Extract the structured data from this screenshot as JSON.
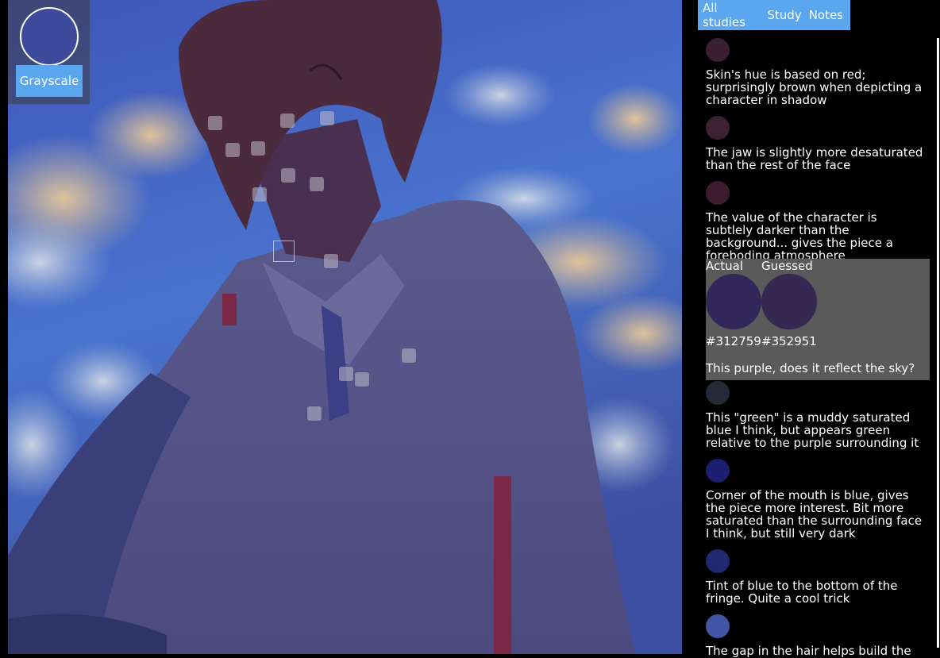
{
  "grayscale": {
    "button_label": "Grayscale",
    "swatch_color": "#3e4a9c"
  },
  "nav": {
    "items": [
      "All studies",
      "Study",
      "Notes"
    ],
    "accent_color": "#5aa7ef"
  },
  "notes": [
    {
      "color": "#3a1f33",
      "text": "Skin's hue is based on red; surprisingly brown when depicting a character in shadow"
    },
    {
      "color": "#3b2132",
      "text": "The jaw is slightly more desaturated than the rest of the face"
    },
    {
      "color": "#3e1c30",
      "text": "The value of the character is subtlely darker than the background... gives the piece a foreboding atmosphere"
    },
    {
      "color": "#252b36",
      "text": "This \"green\" is a muddy saturated blue I think, but appears green relative to the purple surrounding it"
    },
    {
      "color": "#1c1e6f",
      "text": "Corner of the mouth is blue, gives the piece more interest. Bit more saturated than the surrounding face I think, but still very dark"
    },
    {
      "color": "#1e2a6d",
      "text": "Tint of blue to the bottom of the fringe. Quite a cool trick"
    },
    {
      "color": "#4254a3",
      "text": "The gap in the hair helps build the"
    }
  ],
  "active_note": {
    "actual_label": "Actual",
    "guessed_label": "Guessed",
    "actual_hex": "#312759",
    "guessed_hex": "#352951",
    "actual_color": "#312759",
    "guessed_color": "#352951",
    "comment": "This purple, does it reflect the sky?"
  }
}
